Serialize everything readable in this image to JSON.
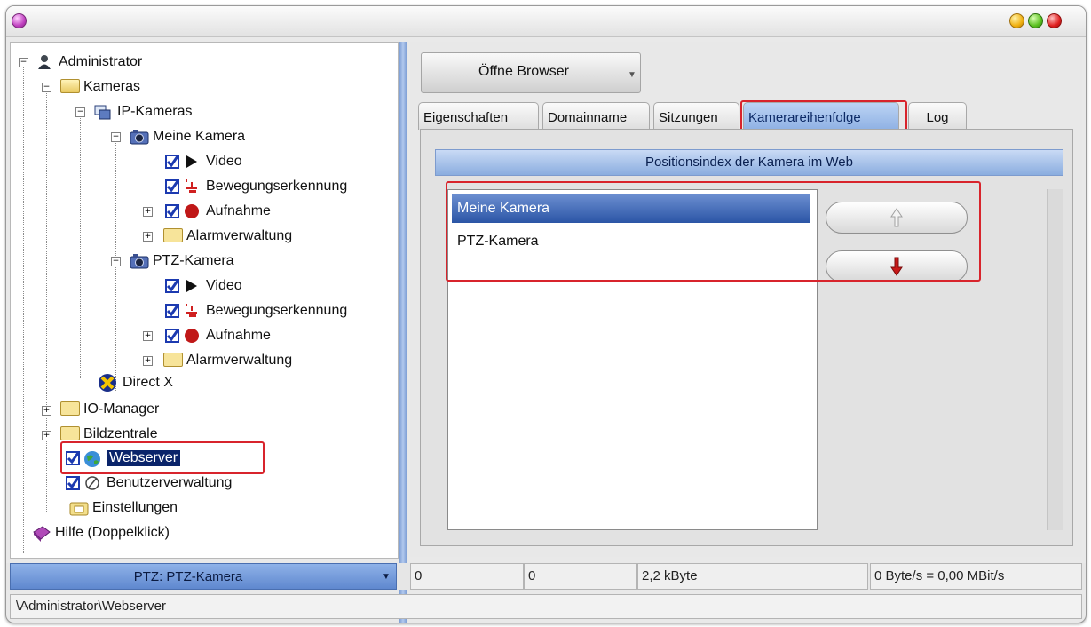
{
  "window": {
    "menu_orb": "magenta-orb",
    "min_orb": "yellow-orb",
    "max_orb": "green-orb",
    "close_orb": "red-orb"
  },
  "tree": {
    "administrator": "Administrator",
    "kameras": "Kameras",
    "ip_kameras": "IP-Kameras",
    "meine_kamera": "Meine Kamera",
    "mk_video": "Video",
    "mk_bewegung": "Bewegungserkennung",
    "mk_aufnahme": "Aufnahme",
    "mk_alarm": "Alarmverwaltung",
    "ptz_kamera": "PTZ-Kamera",
    "ptz_video": "Video",
    "ptz_bewegung": "Bewegungserkennung",
    "ptz_aufnahme": "Aufnahme",
    "ptz_alarm": "Alarmverwaltung",
    "directx": "Direct X",
    "io_manager": "IO-Manager",
    "bildzentrale": "Bildzentrale",
    "webserver": "Webserver",
    "benutzer": "Benutzerverwaltung",
    "einstellungen": "Einstellungen",
    "hilfe": "Hilfe (Doppelklick)"
  },
  "toolbar": {
    "browser_button": "Öffne Browser"
  },
  "tabs": [
    {
      "label": "Eigenschaften",
      "active": false
    },
    {
      "label": "Domainname",
      "active": false
    },
    {
      "label": "Sitzungen",
      "active": false
    },
    {
      "label": "Kamerareihenfolge",
      "active": true
    },
    {
      "label": "Log",
      "active": false
    }
  ],
  "panel": {
    "header": "Positionsindex der Kamera im Web",
    "cameras": [
      "Meine Kamera",
      "PTZ-Kamera"
    ],
    "selected_index": 0
  },
  "status": {
    "camera_select": "PTZ: PTZ-Kamera",
    "cell1": "0",
    "cell2": "0",
    "cell3": "2,2 kByte",
    "cell4": "0 Byte/s = 0,00 MBit/s",
    "path": "\\Administrator\\Webserver"
  },
  "colors": {
    "highlight": "#d8242c",
    "selection": "#0a246a",
    "accent": "#8aaddf"
  }
}
